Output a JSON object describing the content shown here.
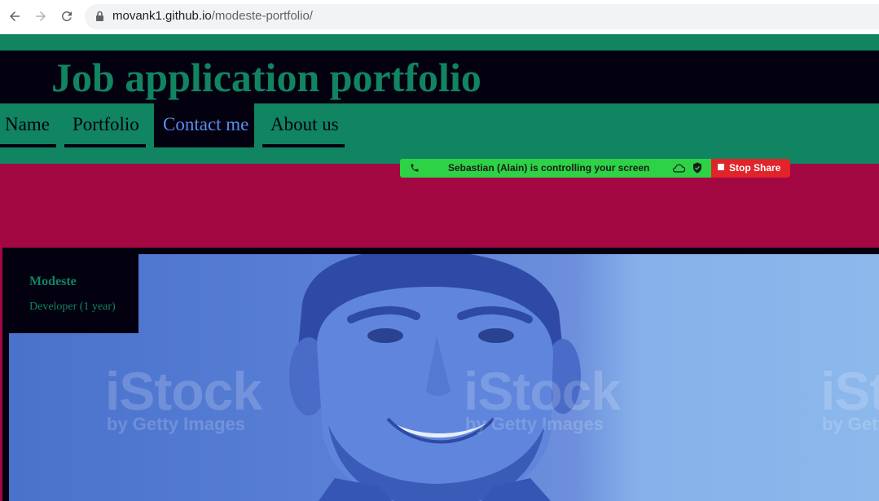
{
  "browser": {
    "url_host": "movank1.github.io",
    "url_path": "/modeste-portfolio/"
  },
  "site": {
    "title": "Job application portfolio",
    "nav": [
      {
        "label": "Name",
        "active": false
      },
      {
        "label": "Portfolio",
        "active": false
      },
      {
        "label": "Contact me",
        "active": true
      },
      {
        "label": "About us",
        "active": false
      }
    ],
    "colors": {
      "green": "#118462",
      "dark": "#03000f",
      "magenta": "#a30843",
      "active_link": "#5b8def"
    }
  },
  "share_banner": {
    "message": "Sebastian (Alain) is controlling your screen",
    "stop_label": "Stop Share",
    "bar_color": "#2dd245",
    "stop_color": "#e0242a"
  },
  "profile": {
    "name": "Modeste",
    "role": "Developer (1 year)",
    "watermark_brand": "iStock",
    "watermark_sub": "by Getty Images"
  }
}
